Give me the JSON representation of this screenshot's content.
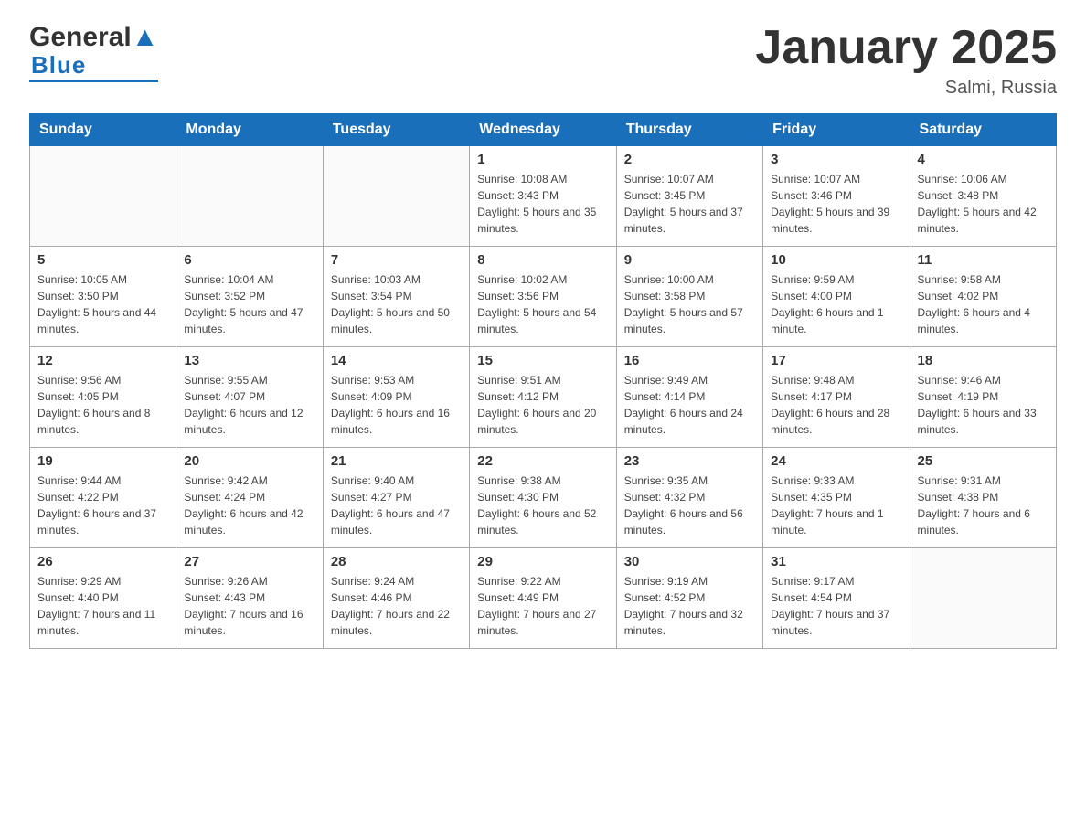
{
  "header": {
    "logo_general": "General",
    "logo_blue": "Blue",
    "title": "January 2025",
    "subtitle": "Salmi, Russia"
  },
  "weekdays": [
    "Sunday",
    "Monday",
    "Tuesday",
    "Wednesday",
    "Thursday",
    "Friday",
    "Saturday"
  ],
  "weeks": [
    [
      {
        "day": "",
        "sunrise": "",
        "sunset": "",
        "daylight": ""
      },
      {
        "day": "",
        "sunrise": "",
        "sunset": "",
        "daylight": ""
      },
      {
        "day": "",
        "sunrise": "",
        "sunset": "",
        "daylight": ""
      },
      {
        "day": "1",
        "sunrise": "Sunrise: 10:08 AM",
        "sunset": "Sunset: 3:43 PM",
        "daylight": "Daylight: 5 hours and 35 minutes."
      },
      {
        "day": "2",
        "sunrise": "Sunrise: 10:07 AM",
        "sunset": "Sunset: 3:45 PM",
        "daylight": "Daylight: 5 hours and 37 minutes."
      },
      {
        "day": "3",
        "sunrise": "Sunrise: 10:07 AM",
        "sunset": "Sunset: 3:46 PM",
        "daylight": "Daylight: 5 hours and 39 minutes."
      },
      {
        "day": "4",
        "sunrise": "Sunrise: 10:06 AM",
        "sunset": "Sunset: 3:48 PM",
        "daylight": "Daylight: 5 hours and 42 minutes."
      }
    ],
    [
      {
        "day": "5",
        "sunrise": "Sunrise: 10:05 AM",
        "sunset": "Sunset: 3:50 PM",
        "daylight": "Daylight: 5 hours and 44 minutes."
      },
      {
        "day": "6",
        "sunrise": "Sunrise: 10:04 AM",
        "sunset": "Sunset: 3:52 PM",
        "daylight": "Daylight: 5 hours and 47 minutes."
      },
      {
        "day": "7",
        "sunrise": "Sunrise: 10:03 AM",
        "sunset": "Sunset: 3:54 PM",
        "daylight": "Daylight: 5 hours and 50 minutes."
      },
      {
        "day": "8",
        "sunrise": "Sunrise: 10:02 AM",
        "sunset": "Sunset: 3:56 PM",
        "daylight": "Daylight: 5 hours and 54 minutes."
      },
      {
        "day": "9",
        "sunrise": "Sunrise: 10:00 AM",
        "sunset": "Sunset: 3:58 PM",
        "daylight": "Daylight: 5 hours and 57 minutes."
      },
      {
        "day": "10",
        "sunrise": "Sunrise: 9:59 AM",
        "sunset": "Sunset: 4:00 PM",
        "daylight": "Daylight: 6 hours and 1 minute."
      },
      {
        "day": "11",
        "sunrise": "Sunrise: 9:58 AM",
        "sunset": "Sunset: 4:02 PM",
        "daylight": "Daylight: 6 hours and 4 minutes."
      }
    ],
    [
      {
        "day": "12",
        "sunrise": "Sunrise: 9:56 AM",
        "sunset": "Sunset: 4:05 PM",
        "daylight": "Daylight: 6 hours and 8 minutes."
      },
      {
        "day": "13",
        "sunrise": "Sunrise: 9:55 AM",
        "sunset": "Sunset: 4:07 PM",
        "daylight": "Daylight: 6 hours and 12 minutes."
      },
      {
        "day": "14",
        "sunrise": "Sunrise: 9:53 AM",
        "sunset": "Sunset: 4:09 PM",
        "daylight": "Daylight: 6 hours and 16 minutes."
      },
      {
        "day": "15",
        "sunrise": "Sunrise: 9:51 AM",
        "sunset": "Sunset: 4:12 PM",
        "daylight": "Daylight: 6 hours and 20 minutes."
      },
      {
        "day": "16",
        "sunrise": "Sunrise: 9:49 AM",
        "sunset": "Sunset: 4:14 PM",
        "daylight": "Daylight: 6 hours and 24 minutes."
      },
      {
        "day": "17",
        "sunrise": "Sunrise: 9:48 AM",
        "sunset": "Sunset: 4:17 PM",
        "daylight": "Daylight: 6 hours and 28 minutes."
      },
      {
        "day": "18",
        "sunrise": "Sunrise: 9:46 AM",
        "sunset": "Sunset: 4:19 PM",
        "daylight": "Daylight: 6 hours and 33 minutes."
      }
    ],
    [
      {
        "day": "19",
        "sunrise": "Sunrise: 9:44 AM",
        "sunset": "Sunset: 4:22 PM",
        "daylight": "Daylight: 6 hours and 37 minutes."
      },
      {
        "day": "20",
        "sunrise": "Sunrise: 9:42 AM",
        "sunset": "Sunset: 4:24 PM",
        "daylight": "Daylight: 6 hours and 42 minutes."
      },
      {
        "day": "21",
        "sunrise": "Sunrise: 9:40 AM",
        "sunset": "Sunset: 4:27 PM",
        "daylight": "Daylight: 6 hours and 47 minutes."
      },
      {
        "day": "22",
        "sunrise": "Sunrise: 9:38 AM",
        "sunset": "Sunset: 4:30 PM",
        "daylight": "Daylight: 6 hours and 52 minutes."
      },
      {
        "day": "23",
        "sunrise": "Sunrise: 9:35 AM",
        "sunset": "Sunset: 4:32 PM",
        "daylight": "Daylight: 6 hours and 56 minutes."
      },
      {
        "day": "24",
        "sunrise": "Sunrise: 9:33 AM",
        "sunset": "Sunset: 4:35 PM",
        "daylight": "Daylight: 7 hours and 1 minute."
      },
      {
        "day": "25",
        "sunrise": "Sunrise: 9:31 AM",
        "sunset": "Sunset: 4:38 PM",
        "daylight": "Daylight: 7 hours and 6 minutes."
      }
    ],
    [
      {
        "day": "26",
        "sunrise": "Sunrise: 9:29 AM",
        "sunset": "Sunset: 4:40 PM",
        "daylight": "Daylight: 7 hours and 11 minutes."
      },
      {
        "day": "27",
        "sunrise": "Sunrise: 9:26 AM",
        "sunset": "Sunset: 4:43 PM",
        "daylight": "Daylight: 7 hours and 16 minutes."
      },
      {
        "day": "28",
        "sunrise": "Sunrise: 9:24 AM",
        "sunset": "Sunset: 4:46 PM",
        "daylight": "Daylight: 7 hours and 22 minutes."
      },
      {
        "day": "29",
        "sunrise": "Sunrise: 9:22 AM",
        "sunset": "Sunset: 4:49 PM",
        "daylight": "Daylight: 7 hours and 27 minutes."
      },
      {
        "day": "30",
        "sunrise": "Sunrise: 9:19 AM",
        "sunset": "Sunset: 4:52 PM",
        "daylight": "Daylight: 7 hours and 32 minutes."
      },
      {
        "day": "31",
        "sunrise": "Sunrise: 9:17 AM",
        "sunset": "Sunset: 4:54 PM",
        "daylight": "Daylight: 7 hours and 37 minutes."
      },
      {
        "day": "",
        "sunrise": "",
        "sunset": "",
        "daylight": ""
      }
    ]
  ]
}
